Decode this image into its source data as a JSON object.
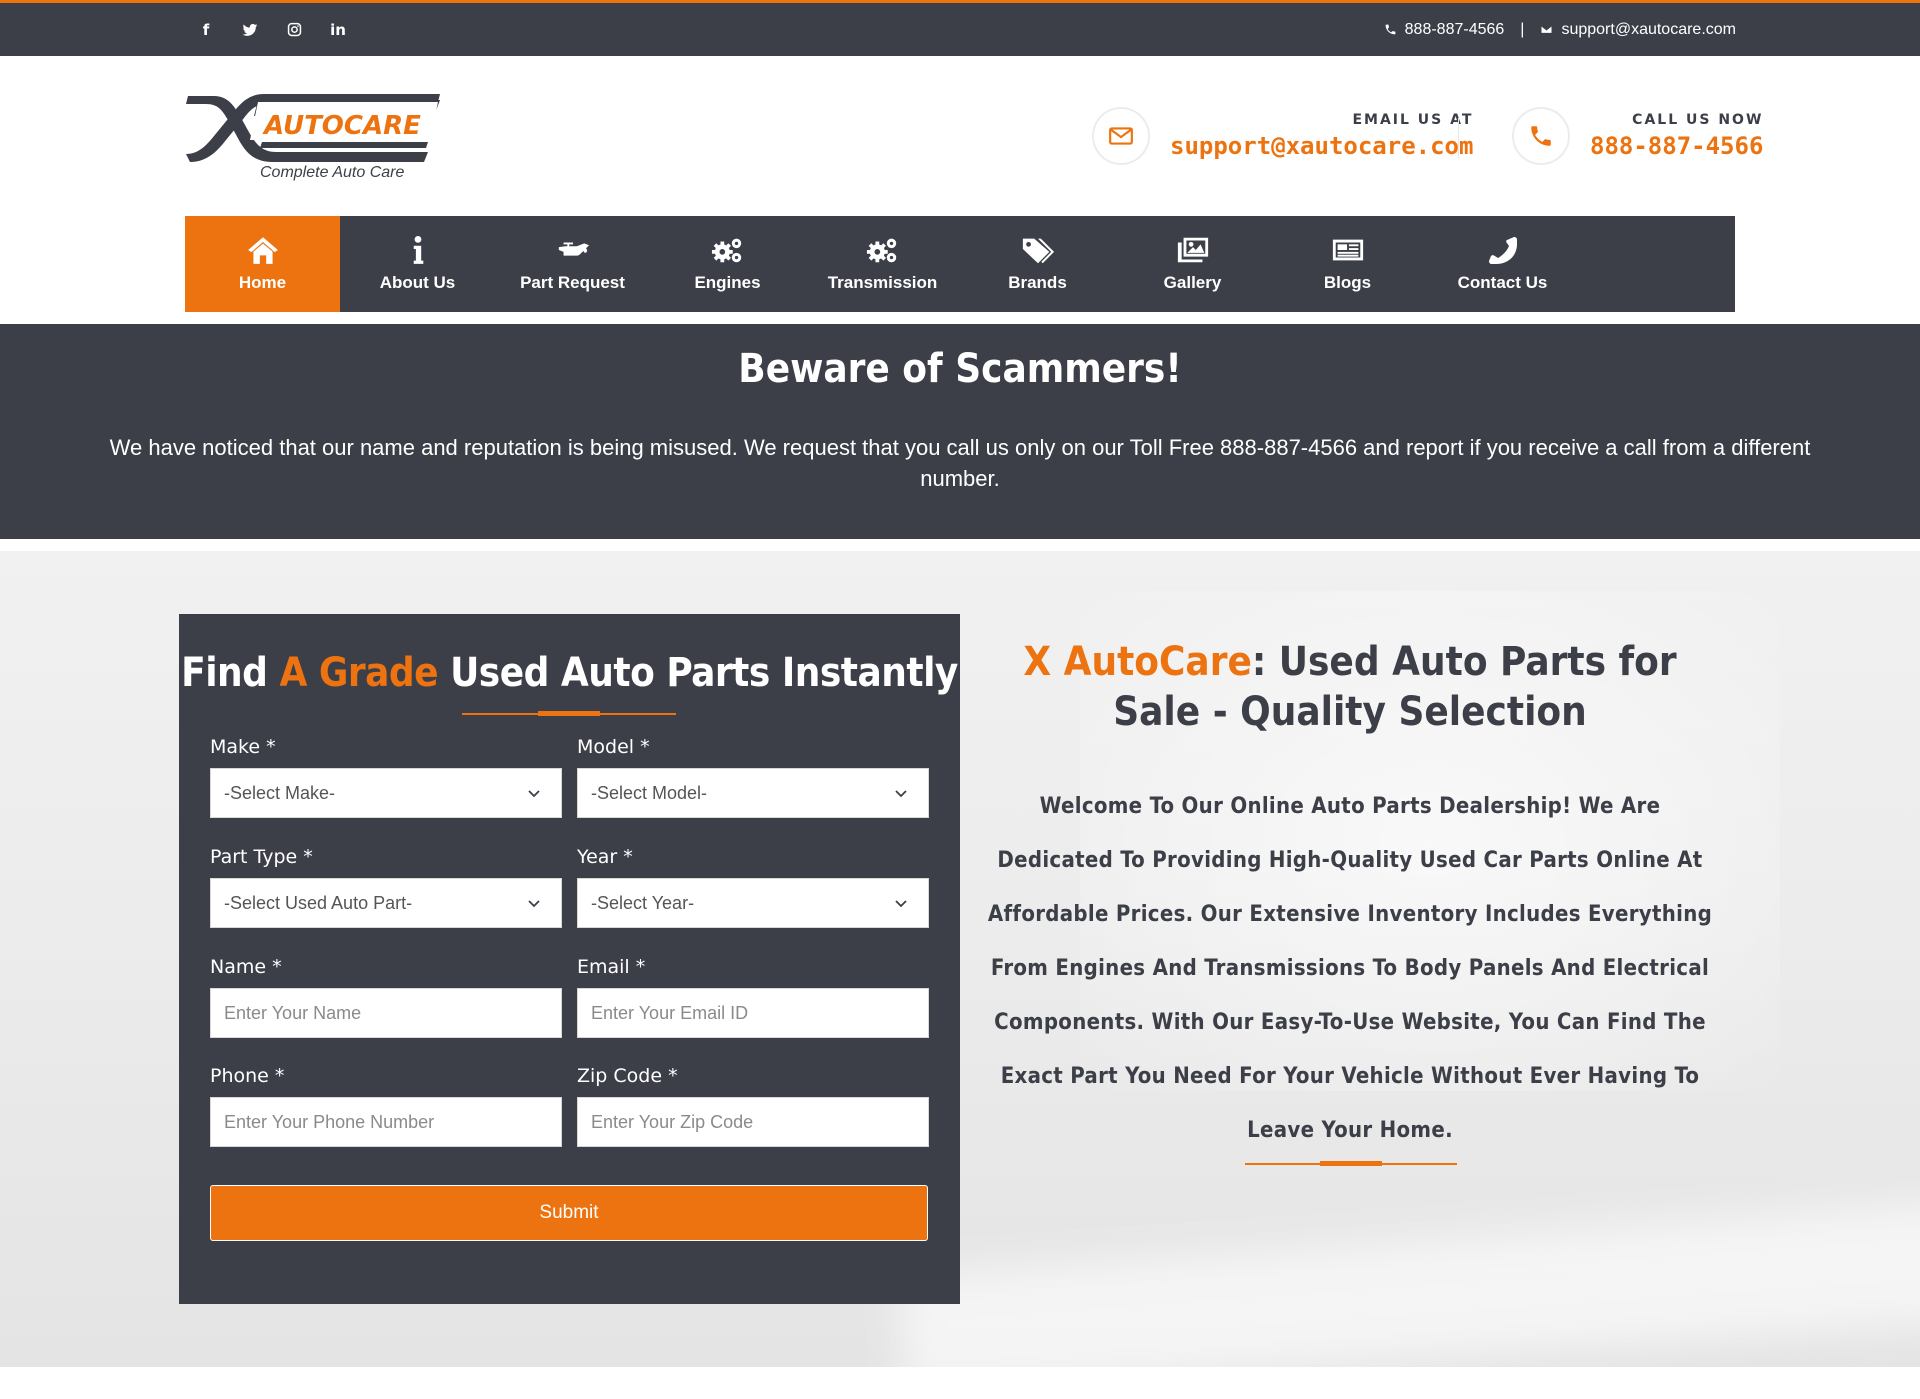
{
  "topbar": {
    "social": [
      {
        "name": "facebook-icon",
        "glyph": "f"
      },
      {
        "name": "twitter-icon",
        "glyph": "t"
      },
      {
        "name": "instagram-icon",
        "glyph": "◎"
      },
      {
        "name": "linkedin-icon",
        "glyph": "in"
      }
    ],
    "phone": "888-887-4566",
    "separator": "|",
    "email": "support@xautocare.com"
  },
  "header": {
    "logo_text": "AUTOCARE",
    "logo_tagline": "Complete Auto Care",
    "email_label": "EMAIL US AT",
    "email_value": "support@xautocare.com",
    "call_label": "CALL US NOW",
    "call_value": "888-887-4566"
  },
  "nav": {
    "items": [
      {
        "label": "Home",
        "icon": "home-icon",
        "active": true
      },
      {
        "label": "About Us",
        "icon": "info-icon"
      },
      {
        "label": "Part Request",
        "icon": "oil-can-icon"
      },
      {
        "label": "Engines",
        "icon": "cogs-icon"
      },
      {
        "label": "Transmission",
        "icon": "cogs-icon"
      },
      {
        "label": "Brands",
        "icon": "tags-icon"
      },
      {
        "label": "Gallery",
        "icon": "images-icon"
      },
      {
        "label": "Blogs",
        "icon": "newspaper-icon"
      },
      {
        "label": "Contact Us",
        "icon": "phone-icon"
      }
    ]
  },
  "scam": {
    "title": "Beware of Scammers!",
    "message": "We have noticed that our name and reputation is being misused. We request that you call us only on our Toll Free 888-887-4566 and report if you receive a call from a different number."
  },
  "form": {
    "title_pre": "Find ",
    "title_accent": "A Grade",
    "title_post": " Used Auto Parts Instantly",
    "make_label": "Make *",
    "make_value": "-Select Make-",
    "model_label": "Model *",
    "model_value": "-Select Model-",
    "part_label": "Part Type *",
    "part_value": "-Select Used Auto Part-",
    "year_label": "Year *",
    "year_value": "-Select Year-",
    "name_label": "Name *",
    "name_placeholder": "Enter Your Name",
    "email_label": "Email *",
    "email_placeholder": "Enter Your Email ID",
    "phone_label": "Phone *",
    "phone_placeholder": "Enter Your Phone Number",
    "zip_label": "Zip Code *",
    "zip_placeholder": "Enter Your Zip Code",
    "submit_label": "Submit"
  },
  "about": {
    "title_accent": "X AutoCare",
    "title_rest": ": Used Auto Parts for Sale - Quality Selection",
    "body": "Welcome To Our Online Auto Parts Dealership! We Are Dedicated To Providing High-Quality Used Car Parts Online At Affordable Prices. Our Extensive Inventory Includes Everything From Engines And Transmissions To Body Panels And Electrical Components. With Our Easy-To-Use Website, You Can Find The Exact Part You Need For Your Vehicle Without Ever Having To Leave Your Home."
  },
  "colors": {
    "accent": "#ec7310",
    "dark": "#3c3f48"
  }
}
